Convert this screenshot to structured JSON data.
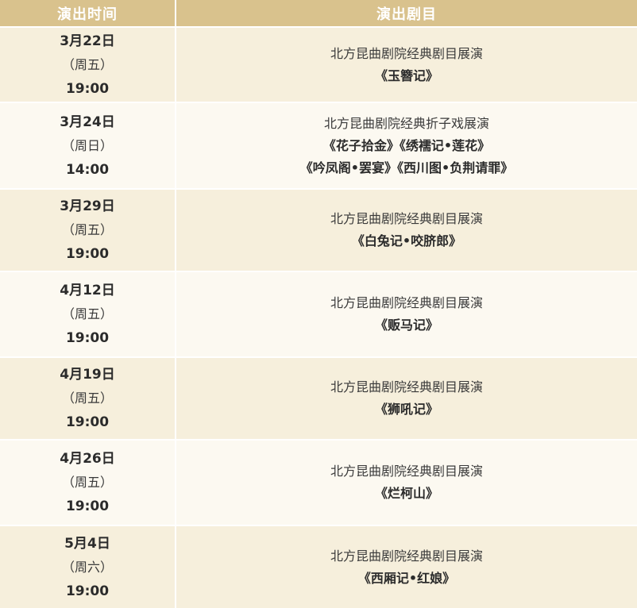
{
  "header": {
    "time_col": "演出时间",
    "program_col": "演出剧目"
  },
  "rows": [
    {
      "date": "3月22日",
      "weekday": "（周五）",
      "time": "19:00",
      "series": "北方昆曲剧院经典剧目展演",
      "titles": [
        "《玉簪记》"
      ]
    },
    {
      "date": "3月24日",
      "weekday": "（周日）",
      "time": "14:00",
      "series": "北方昆曲剧院经典折子戏展演",
      "titles": [
        "《花子拾金》《绣襦记•莲花》",
        "《吟凤阁•罢宴》《西川图•负荆请罪》"
      ]
    },
    {
      "date": "3月29日",
      "weekday": "（周五）",
      "time": "19:00",
      "series": "北方昆曲剧院经典剧目展演",
      "titles": [
        "《白兔记•咬脐郎》"
      ]
    },
    {
      "date": "4月12日",
      "weekday": "（周五）",
      "time": "19:00",
      "series": "北方昆曲剧院经典剧目展演",
      "titles": [
        "《贩马记》"
      ]
    },
    {
      "date": "4月19日",
      "weekday": "（周五）",
      "time": "19:00",
      "series": "北方昆曲剧院经典剧目展演",
      "titles": [
        "《狮吼记》"
      ]
    },
    {
      "date": "4月26日",
      "weekday": "（周五）",
      "time": "19:00",
      "series": "北方昆曲剧院经典剧目展演",
      "titles": [
        "《烂柯山》"
      ]
    },
    {
      "date": "5月4日",
      "weekday": "（周六）",
      "time": "19:00",
      "series": "北方昆曲剧院经典剧目展演",
      "titles": [
        "《西厢记•红娘》"
      ]
    }
  ],
  "colors": {
    "header_bg": "#d9c28d",
    "row_odd_bg": "#f6efdc",
    "row_even_bg": "#fcf9f1",
    "divider": "#ffffff"
  }
}
